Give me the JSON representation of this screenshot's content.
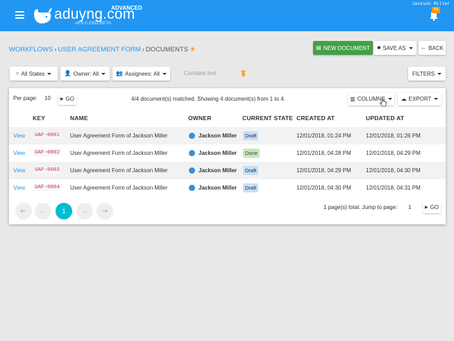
{
  "header": {
    "logo_text": "aduyng.com",
    "edition": "ADVANCED",
    "version": "v6.0.0.2352.BETA",
    "user_name": "Jackson Miller",
    "notification_count": "9+"
  },
  "breadcrumb": {
    "items": [
      "WORKFLOWS",
      "USER AGREEMENT FORM"
    ],
    "current": "DOCUMENTS"
  },
  "actions": {
    "new_document": "NEW DOCUMENT",
    "save_as": "SAVE AS",
    "back": "BACK"
  },
  "filters": {
    "state": "All States",
    "owner": "Owner: All",
    "assignees": "Assignees: All",
    "contains_placeholder": "Contains text",
    "filters_button": "FILTERS"
  },
  "table_toolbar": {
    "per_page_label": "Per page:",
    "per_page_value": "10",
    "go": "GO",
    "matched_text": "4/4 document(s) matched. Showing 4 document(s) from 1 to 4.",
    "columns": "COLUMNS",
    "export": "EXPORT"
  },
  "table": {
    "columns": [
      "KEY",
      "NAME",
      "OWNER",
      "CURRENT STATE",
      "CREATED AT",
      "UPDATED AT"
    ],
    "view_label": "View",
    "rows": [
      {
        "key": "UAF-0001",
        "name": "User Agreement Form of Jackson Miller",
        "owner": "Jackson Miller",
        "state": "Draft",
        "created": "12/01/2018, 01:24 PM",
        "updated": "12/01/2018, 01:26 PM"
      },
      {
        "key": "UAF-0002",
        "name": "User Agreement Form of Jackson Miller",
        "owner": "Jackson Miller",
        "state": "Done",
        "created": "12/01/2018, 04:28 PM",
        "updated": "12/01/2018, 04:29 PM"
      },
      {
        "key": "UAF-0003",
        "name": "User Agreement Form of Jackson Miller",
        "owner": "Jackson Miller",
        "state": "Draft",
        "created": "12/01/2018, 04:29 PM",
        "updated": "12/01/2018, 04:30 PM"
      },
      {
        "key": "UAF-0004",
        "name": "User Agreement Form of Jackson Miller",
        "owner": "Jackson Miller",
        "state": "Draft",
        "created": "12/01/2018, 04:30 PM",
        "updated": "12/01/2018, 04:31 PM"
      }
    ]
  },
  "pagination": {
    "current_page": "1",
    "total_text": "1 page(s) total. Jump to page:",
    "jump_value": "1",
    "go": "GO"
  },
  "colors": {
    "primary": "#2196f3",
    "success": "#43a047",
    "accent": "#00bcd4",
    "badge": "#ff9800"
  }
}
